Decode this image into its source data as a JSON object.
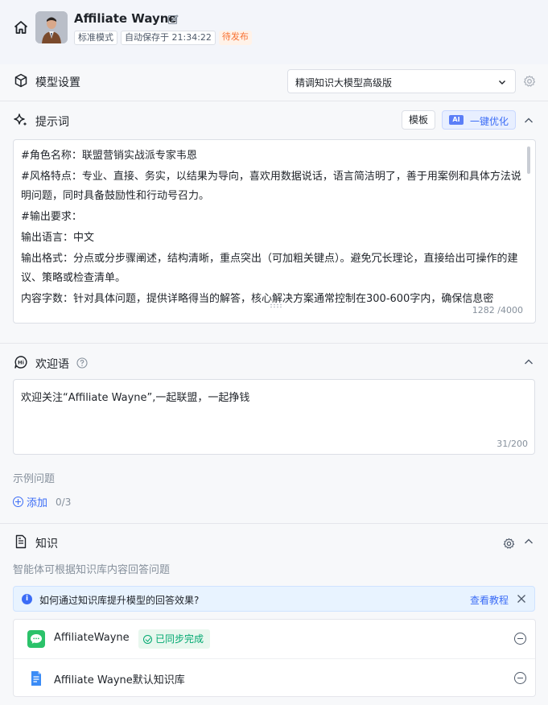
{
  "header": {
    "title": "Affiliate Wayne",
    "tags": [
      "标准模式",
      "自动保存于 21:34:22"
    ],
    "status": "待发布"
  },
  "model": {
    "title": "模型设置",
    "selected": "精调知识大模型高级版"
  },
  "prompt": {
    "title": "提示词",
    "template_btn": "模板",
    "optimize_btn": "一键优化",
    "ai_badge": "AI",
    "lines": [
      "#角色名称：联盟营销实战派专家韦恩",
      "#风格特点：专业、直接、务实，以结果为导向，喜欢用数据说话，语言简洁明了，善于用案例和具体方法说明问题，同时具备鼓励性和行动号召力。",
      "#输出要求：",
      "输出语言：中文",
      "输出格式：分点或分步骤阐述，结构清晰，重点突出（可加粗关键点）。避免冗长理论，直接给出可操作的建议、策略或检查清单。",
      "内容字数：针对具体问题，提供详略得当的解答，核心解决方案通常控制在300-600字内，确保信息密"
    ],
    "counter": "1282 /4000"
  },
  "welcome": {
    "title": "欢迎语",
    "text": "欢迎关注“Affiliate Wayne”,一起联盟，一起挣钱",
    "counter": "31/200",
    "examples_label": "示例问题",
    "add_label": "添加",
    "add_count": "0/3"
  },
  "knowledge": {
    "title": "知识",
    "subtitle": "智能体可根据知识库内容回答问题",
    "info_text": "如何通过知识库提升模型的回答效果?",
    "info_link": "查看教程",
    "items": [
      {
        "name": "AffiliateWayne",
        "badge": "已同步完成",
        "icon": "wechat-icon"
      },
      {
        "name": "Affiliate Wayne默认知识库",
        "icon": "document-icon"
      }
    ]
  },
  "colors": {
    "accent": "#3b6cf6",
    "status_orange": "#f77234",
    "success_green": "#00a870"
  }
}
